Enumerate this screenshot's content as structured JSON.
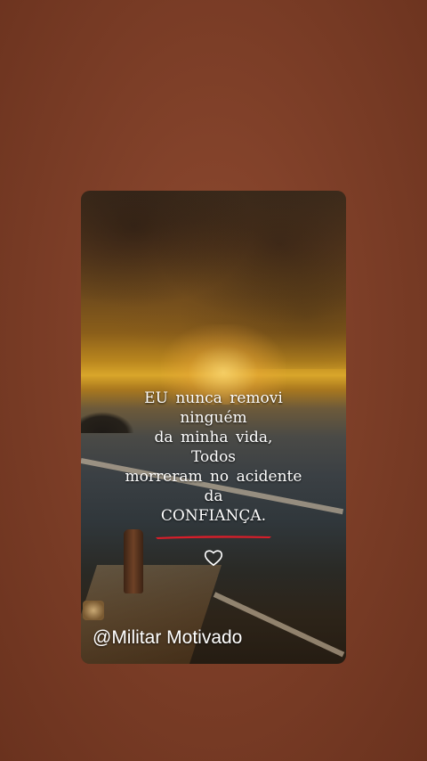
{
  "quote": {
    "lines": [
      "EU nunca removi",
      "ninguém",
      "da minha vida,",
      "Todos",
      "morreram no acidente",
      "da",
      "CONFIANÇA."
    ]
  },
  "handle": "@Militar Motivado",
  "icons": {
    "like": "heart-outline-icon"
  },
  "colors": {
    "background": "#7e3f28",
    "underline": "#d81e2a",
    "text": "#ffffff"
  }
}
